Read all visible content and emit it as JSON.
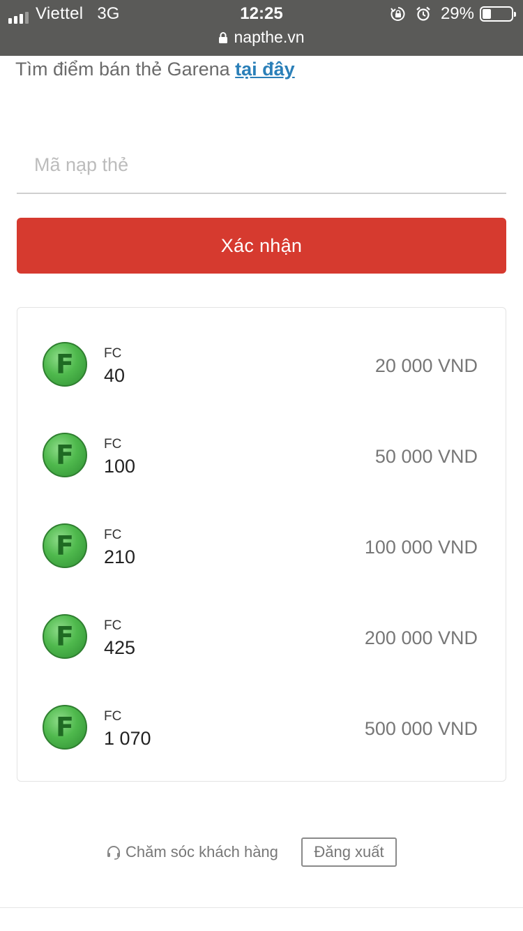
{
  "status_bar": {
    "carrier": "Viettel",
    "network": "3G",
    "time": "12:25",
    "battery_percent": "29%",
    "battery_level": 0.29,
    "icons": [
      "signal-icon",
      "rotation-lock-icon",
      "alarm-icon",
      "battery-icon"
    ]
  },
  "browser": {
    "url": "napthe.vn",
    "secure_icon": "lock-icon"
  },
  "find_store": {
    "text": "Tìm điểm bán thẻ Garena ",
    "link_label": "tại đây"
  },
  "code_input": {
    "placeholder": "Mã nạp thẻ",
    "value": ""
  },
  "confirm_button": {
    "label": "Xác nhận",
    "color": "#d63a2f"
  },
  "packages": [
    {
      "icon": "fc-coin-icon",
      "coin_letter": "F",
      "unit": "FC",
      "amount": "40",
      "price": "20 000 VND"
    },
    {
      "icon": "fc-coin-icon",
      "coin_letter": "F",
      "unit": "FC",
      "amount": "100",
      "price": "50 000 VND"
    },
    {
      "icon": "fc-coin-icon",
      "coin_letter": "F",
      "unit": "FC",
      "amount": "210",
      "price": "100 000 VND"
    },
    {
      "icon": "fc-coin-icon",
      "coin_letter": "F",
      "unit": "FC",
      "amount": "425",
      "price": "200 000 VND"
    },
    {
      "icon": "fc-coin-icon",
      "coin_letter": "F",
      "unit": "FC",
      "amount": "1 070",
      "price": "500 000 VND"
    }
  ],
  "footer": {
    "support_icon": "headset-icon",
    "support_label": "Chăm sóc khách hàng",
    "logout_label": "Đăng xuất"
  },
  "colors": {
    "status_bar_bg": "#5a5a58",
    "link": "#2a7fb8",
    "coin_green": "#4fb94d"
  }
}
